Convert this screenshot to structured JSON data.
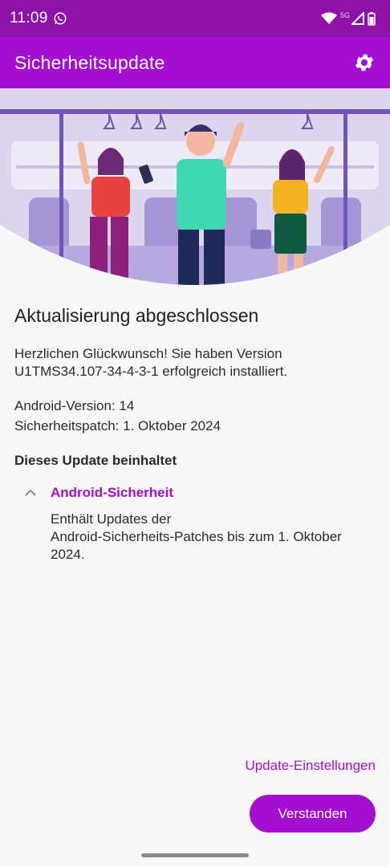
{
  "status": {
    "time": "11:09",
    "network": "5G",
    "icons": [
      "whatsapp-icon",
      "wifi-icon",
      "signal-icon",
      "battery-icon"
    ]
  },
  "app_bar": {
    "title": "Sicherheitsupdate",
    "settings_icon": "gear-icon"
  },
  "main": {
    "heading": "Aktualisierung abgeschlossen",
    "congrats_line1": "Herzlichen Glückwunsch! Sie haben Version",
    "congrats_line2": "U1TMS34.107-34-4-3-1 erfolgreich installiert.",
    "android_version": "Android-Version: 14",
    "security_patch": "Sicherheitspatch: 1. Oktober 2024",
    "section_label": "Dieses Update beinhaltet",
    "expand_item": {
      "title": "Android-Sicherheit",
      "line1": "Enthält Updates der",
      "line2": "Android-Sicherheits-Patches bis zum 1. Oktober",
      "line3": "2024."
    }
  },
  "actions": {
    "settings_link": "Update-Einstellungen",
    "confirm_button": "Verstanden"
  },
  "colors": {
    "status_bar": "#8e12a9",
    "app_bar": "#a30fd0",
    "accent": "#a30fd0",
    "background": "#f8f8f8"
  }
}
